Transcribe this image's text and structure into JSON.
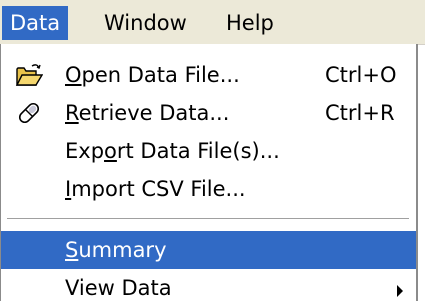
{
  "menubar": {
    "items": [
      {
        "label": "Data",
        "active": true
      },
      {
        "label": "Window",
        "active": false
      },
      {
        "label": "Help",
        "active": false
      }
    ]
  },
  "dropdown": {
    "items": [
      {
        "icon": "open-folder-icon",
        "mnemonic": "O",
        "rest": "pen Data File...",
        "shortcut": "Ctrl+O"
      },
      {
        "icon": "retrieve-pill-icon",
        "mnemonic": "R",
        "rest": "etrieve Data...",
        "shortcut": "Ctrl+R"
      },
      {
        "pre": "Exp",
        "mnemonic": "o",
        "rest": "rt Data File(s)..."
      },
      {
        "mnemonic": "I",
        "rest": "mport CSV File..."
      },
      {
        "mnemonic": "S",
        "rest": "ummary",
        "highlighted": true
      },
      {
        "pre": "View Data",
        "has_submenu": true
      }
    ]
  },
  "colors": {
    "highlight": "#316ac5",
    "highlight_text": "#ffffff",
    "menubar_bg": "#ece9d8"
  }
}
